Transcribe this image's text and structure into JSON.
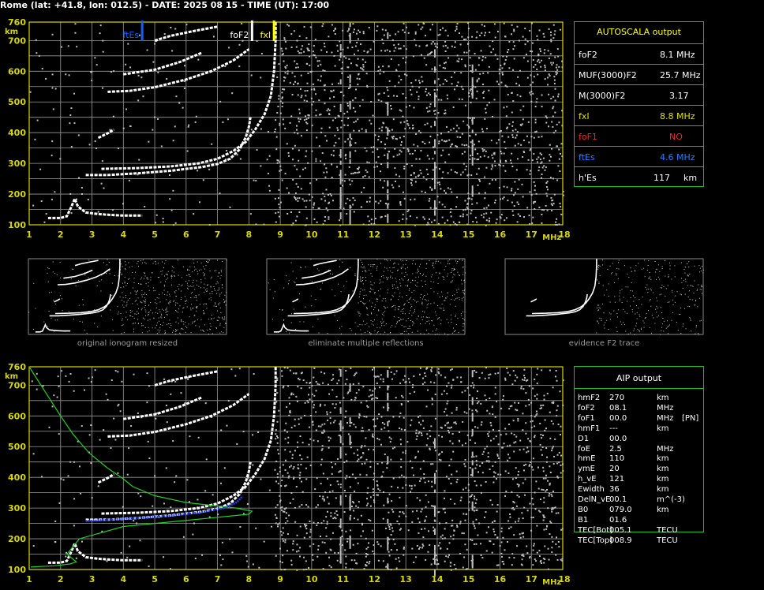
{
  "header": {
    "title": "Rome (lat: +41.8, lon: 012.5) - DATE: 2025 08 15 - TIME (UT): 17:00"
  },
  "colors": {
    "grid": "#9a9a9a",
    "axis": "#d8d800",
    "panel_border": "#20c020",
    "trace": "#ffffff",
    "fxi": "#ffff00",
    "ftes": "#1060ff",
    "fof1": "#ff2020",
    "profile": "#20d020",
    "fit": "#2040ff"
  },
  "chart_data": [
    {
      "type": "scatter",
      "name": "top-ionogram",
      "x_unit": "MHz",
      "y_unit": "km",
      "xlim": [
        1,
        18
      ],
      "ylim": [
        100,
        760
      ],
      "x_ticks": [
        "1",
        "2",
        "3",
        "4",
        "5",
        "6",
        "7",
        "8",
        "9",
        "10",
        "11",
        "12",
        "13",
        "14",
        "15",
        "16",
        "17",
        "18"
      ],
      "y_ticks": [
        "100",
        "200",
        "300",
        "400",
        "500",
        "600",
        "700",
        "760"
      ],
      "markers": [
        {
          "label": "ftEs",
          "x": 4.6,
          "color": "#1060ff"
        },
        {
          "label": "foF2",
          "x": 8.1,
          "color": "#ffffff"
        },
        {
          "label": "fxI",
          "x": 8.8,
          "color": "#ffff00"
        }
      ],
      "traces": [
        {
          "points": [
            [
              1.6,
              122
            ],
            [
              2.0,
              122
            ],
            [
              2.2,
              128
            ],
            [
              2.35,
              160
            ],
            [
              2.45,
              185
            ],
            [
              2.55,
              160
            ],
            [
              2.8,
              140
            ],
            [
              3.2,
              135
            ],
            [
              3.6,
              132
            ],
            [
              4.0,
              130
            ],
            [
              4.6,
              130
            ]
          ]
        },
        {
          "points": [
            [
              2.8,
              262
            ],
            [
              3.5,
              262
            ],
            [
              4.5,
              268
            ],
            [
              5.5,
              276
            ],
            [
              6.5,
              288
            ],
            [
              7.0,
              298
            ],
            [
              7.4,
              315
            ],
            [
              7.7,
              345
            ],
            [
              7.9,
              385
            ],
            [
              8.0,
              420
            ],
            [
              8.05,
              450
            ]
          ]
        },
        {
          "points": [
            [
              3.3,
              282
            ],
            [
              4.5,
              285
            ],
            [
              5.5,
              290
            ],
            [
              6.4,
              300
            ],
            [
              7.0,
              315
            ],
            [
              7.5,
              340
            ],
            [
              7.9,
              370
            ],
            [
              8.2,
              410
            ],
            [
              8.5,
              460
            ],
            [
              8.7,
              520
            ],
            [
              8.8,
              600
            ],
            [
              8.85,
              700
            ],
            [
              8.85,
              760
            ]
          ]
        },
        {
          "points": [
            [
              3.2,
              383
            ],
            [
              3.5,
              398
            ],
            [
              3.7,
              410
            ]
          ]
        },
        {
          "points": [
            [
              3.5,
              533
            ],
            [
              4.2,
              536
            ],
            [
              5.0,
              548
            ],
            [
              6.0,
              573
            ],
            [
              6.8,
              600
            ],
            [
              7.5,
              635
            ],
            [
              8.0,
              672
            ]
          ]
        },
        {
          "points": [
            [
              4.0,
              590
            ],
            [
              5.0,
              605
            ],
            [
              5.8,
              630
            ],
            [
              6.5,
              660
            ]
          ]
        },
        {
          "points": [
            [
              5.0,
              700
            ],
            [
              5.5,
              715
            ],
            [
              6.2,
              730
            ],
            [
              7.0,
              745
            ]
          ]
        }
      ]
    },
    {
      "type": "scatter",
      "name": "bottom-ionogram",
      "x_unit": "MHz",
      "y_unit": "km",
      "xlim": [
        1,
        18
      ],
      "ylim": [
        100,
        760
      ],
      "x_ticks": [
        "1",
        "2",
        "3",
        "4",
        "5",
        "6",
        "7",
        "8",
        "9",
        "10",
        "11",
        "12",
        "13",
        "14",
        "15",
        "16",
        "17",
        "18"
      ],
      "y_ticks": [
        "100",
        "200",
        "300",
        "400",
        "500",
        "600",
        "700",
        "760"
      ],
      "traces": [
        {
          "points": [
            [
              1.6,
              122
            ],
            [
              2.0,
              122
            ],
            [
              2.2,
              128
            ],
            [
              2.35,
              160
            ],
            [
              2.45,
              185
            ],
            [
              2.55,
              160
            ],
            [
              2.8,
              140
            ],
            [
              3.2,
              135
            ],
            [
              3.6,
              132
            ],
            [
              4.0,
              130
            ],
            [
              4.6,
              130
            ]
          ]
        },
        {
          "points": [
            [
              2.8,
              262
            ],
            [
              3.5,
              262
            ],
            [
              4.5,
              268
            ],
            [
              5.5,
              276
            ],
            [
              6.5,
              288
            ],
            [
              7.0,
              298
            ],
            [
              7.4,
              315
            ],
            [
              7.7,
              345
            ],
            [
              7.9,
              385
            ],
            [
              8.0,
              420
            ],
            [
              8.05,
              450
            ]
          ]
        },
        {
          "points": [
            [
              3.3,
              282
            ],
            [
              4.5,
              285
            ],
            [
              5.5,
              290
            ],
            [
              6.4,
              300
            ],
            [
              7.0,
              315
            ],
            [
              7.5,
              340
            ],
            [
              7.9,
              370
            ],
            [
              8.2,
              410
            ],
            [
              8.5,
              460
            ],
            [
              8.7,
              520
            ],
            [
              8.8,
              600
            ],
            [
              8.85,
              700
            ],
            [
              8.85,
              760
            ]
          ]
        },
        {
          "points": [
            [
              3.2,
              383
            ],
            [
              3.5,
              398
            ],
            [
              3.7,
              410
            ]
          ]
        },
        {
          "points": [
            [
              3.5,
              533
            ],
            [
              4.2,
              536
            ],
            [
              5.0,
              548
            ],
            [
              6.0,
              573
            ],
            [
              6.8,
              600
            ],
            [
              7.5,
              635
            ],
            [
              8.0,
              672
            ]
          ]
        },
        {
          "points": [
            [
              4.0,
              590
            ],
            [
              5.0,
              605
            ],
            [
              5.8,
              630
            ],
            [
              6.5,
              660
            ]
          ]
        },
        {
          "points": [
            [
              5.0,
              700
            ],
            [
              5.5,
              715
            ],
            [
              6.2,
              730
            ],
            [
              7.0,
              745
            ]
          ]
        }
      ],
      "profile": [
        [
          1.05,
          108
        ],
        [
          1.8,
          112
        ],
        [
          2.3,
          118
        ],
        [
          2.5,
          125
        ],
        [
          2.2,
          150
        ],
        [
          2.6,
          200
        ],
        [
          4.0,
          240
        ],
        [
          6.5,
          265
        ],
        [
          8.0,
          280
        ],
        [
          8.1,
          290
        ],
        [
          7.6,
          300
        ],
        [
          6.0,
          318
        ],
        [
          5.0,
          340
        ],
        [
          4.3,
          370
        ],
        [
          4.0,
          395
        ],
        [
          3.5,
          430
        ],
        [
          2.9,
          480
        ],
        [
          2.4,
          540
        ],
        [
          2.0,
          600
        ],
        [
          1.5,
          680
        ],
        [
          1.0,
          760
        ]
      ],
      "fit": [
        [
          2.8,
          258
        ],
        [
          3.5,
          262
        ],
        [
          4.5,
          268
        ],
        [
          5.5,
          275
        ],
        [
          6.5,
          287
        ],
        [
          7.2,
          300
        ],
        [
          7.6,
          318
        ],
        [
          7.8,
          338
        ]
      ]
    }
  ],
  "autoscala": {
    "title": "AUTOSCALA output",
    "rows": [
      {
        "label": "foF2",
        "value": "8.1 MHz",
        "color": "#ffffff"
      },
      {
        "label": "MUF(3000)F2",
        "value": "25.7 MHz",
        "color": "#ffffff"
      },
      {
        "label": "M(3000)F2",
        "value": "3.17",
        "color": "#ffffff"
      },
      {
        "label": "fxI",
        "value": "8.8 MHz",
        "color": "#e0e000"
      },
      {
        "label": "foF1",
        "value": "NO",
        "color": "#ff2020"
      },
      {
        "label": "ftEs",
        "value": "4.6 MHz",
        "color": "#2080ff"
      },
      {
        "label": "h'Es",
        "value": "117",
        "unit": "km",
        "color": "#ffffff"
      }
    ]
  },
  "thumbnails": [
    {
      "caption": "original ionogram resized"
    },
    {
      "caption": "eliminate multiple reflections"
    },
    {
      "caption": "evidence F2 trace"
    }
  ],
  "aip": {
    "title": "AIP output",
    "rows": [
      {
        "param": "hmF2",
        "value": "270",
        "unit": "km",
        "extra": ""
      },
      {
        "param": "foF2",
        "value": "08.1",
        "unit": "MHz",
        "extra": ""
      },
      {
        "param": "foF1",
        "value": "00.0",
        "unit": "MHz",
        "extra": "[PN]"
      },
      {
        "param": "hmF1",
        "value": "---",
        "unit": "km",
        "extra": ""
      },
      {
        "param": "D1",
        "value": "00.0",
        "unit": "",
        "extra": ""
      },
      {
        "param": "foE",
        "value": "2.5",
        "unit": "MHz",
        "extra": ""
      },
      {
        "param": "hmE",
        "value": "110",
        "unit": "km",
        "extra": ""
      },
      {
        "param": "ymE",
        "value": "20",
        "unit": "km",
        "extra": ""
      },
      {
        "param": "h_vE",
        "value": "121",
        "unit": "km",
        "extra": ""
      },
      {
        "param": "Ewidth",
        "value": "36",
        "unit": "km",
        "extra": ""
      },
      {
        "param": "DelN_vE",
        "value": "00.1",
        "unit": "m^(-3)",
        "extra": ""
      },
      {
        "param": "B0",
        "value": "079.0",
        "unit": "km",
        "extra": ""
      },
      {
        "param": "B1",
        "value": "01.6",
        "unit": "",
        "extra": ""
      },
      {
        "param": "TEC[Bot]",
        "value": "005.1",
        "unit": "TECU",
        "extra": ""
      },
      {
        "param": "TEC[Top]",
        "value": "008.9",
        "unit": "TECU",
        "extra": ""
      }
    ]
  },
  "labels": {
    "axis_km": "km",
    "axis_mhz": "MHz"
  }
}
